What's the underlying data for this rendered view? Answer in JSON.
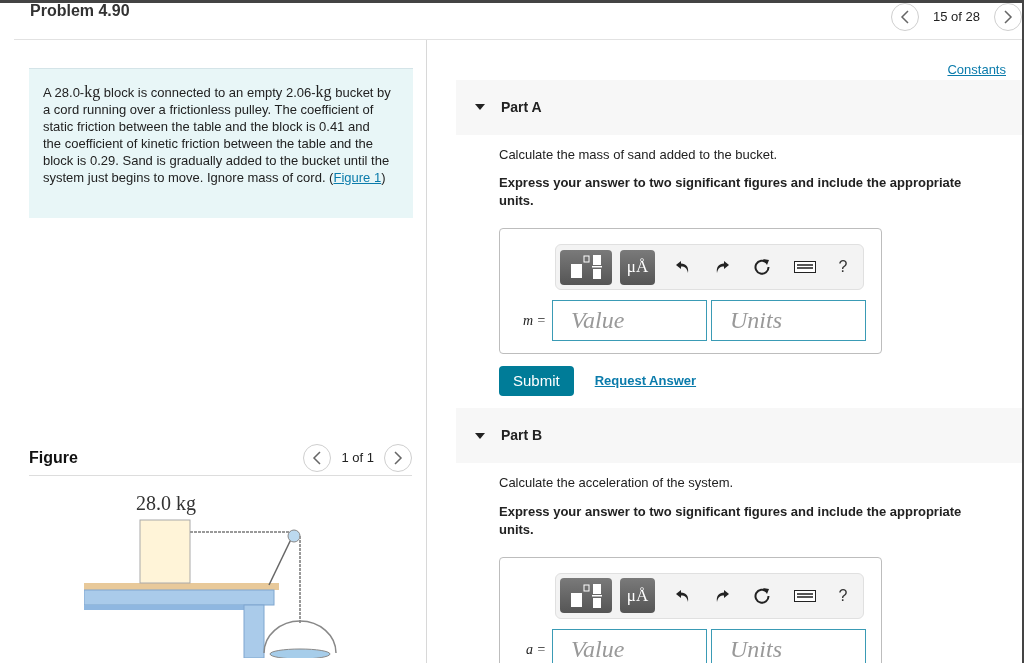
{
  "header": {
    "title": "Problem 4.90",
    "counter": "15 of 28"
  },
  "problem": {
    "segments": [
      {
        "kind": "text",
        "text": "A 28.0-"
      },
      {
        "kind": "math",
        "text": "kg"
      },
      {
        "kind": "text",
        "text": " block is connected to an empty 2.06-"
      },
      {
        "kind": "math",
        "text": "kg"
      },
      {
        "kind": "text",
        "text": " bucket by a cord running over a frictionless pulley. The coefficient of static friction between the table and the block is 0.41 and the coefficient of kinetic friction between the table and the block is 0.29. Sand is gradually added to the bucket until the system just begins to move. Ignore mass of cord. ("
      },
      {
        "kind": "link",
        "text": "Figure 1"
      },
      {
        "kind": "text",
        "text": ")"
      }
    ]
  },
  "figure": {
    "title": "Figure",
    "counter": "1 of 1",
    "mass_label": "28.0 kg"
  },
  "constants_link": "Constants",
  "parts": [
    {
      "label": "Part A",
      "expanded": true,
      "prompt": "Calculate the mass of sand added to the bucket.",
      "instruction": "Express your answer to two significant figures and include the appropriate units.",
      "units_button": "μÅ",
      "help": "?",
      "variable": "m =",
      "value_placeholder": "Value",
      "units_placeholder": "Units",
      "submit": "Submit",
      "request": "Request Answer"
    },
    {
      "label": "Part B",
      "expanded": true,
      "prompt": "Calculate the acceleration of the system.",
      "instruction": "Express your answer to two significant figures and include the appropriate units.",
      "units_button": "μÅ",
      "help": "?",
      "variable": "a =",
      "value_placeholder": "Value",
      "units_placeholder": "Units"
    }
  ]
}
